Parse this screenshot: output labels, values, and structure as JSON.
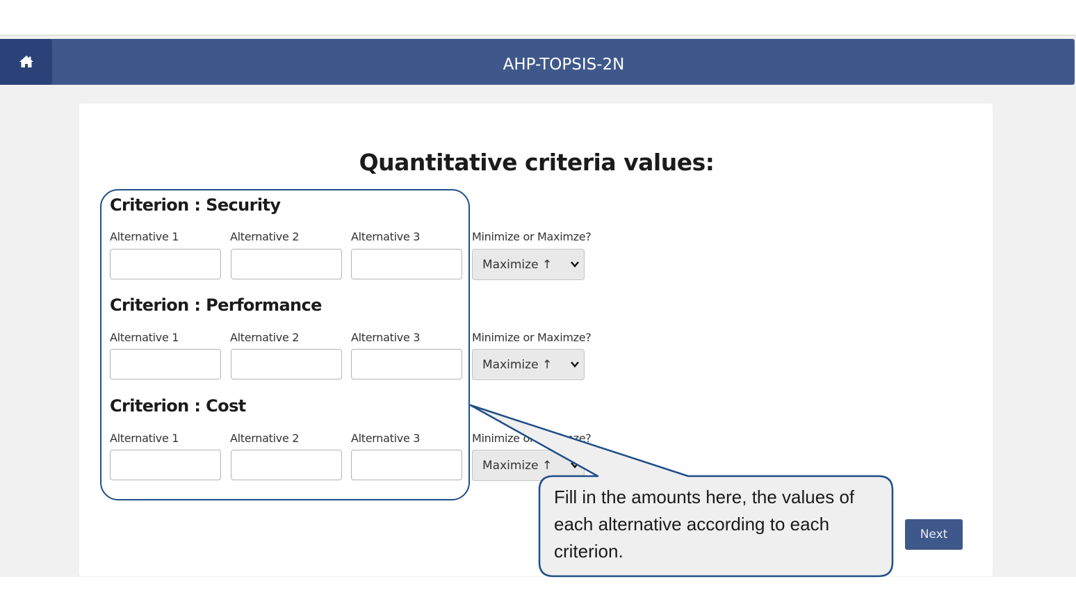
{
  "header": {
    "title": "AHP-TOPSIS-2N",
    "home_icon": "home-icon"
  },
  "page": {
    "title": "Quantitative criteria values:"
  },
  "criteria": [
    {
      "title": "Criterion : Security",
      "alt_labels": [
        "Alternative 1",
        "Alternative 2",
        "Alternative 3"
      ],
      "values": [
        "",
        "",
        ""
      ],
      "direction_label": "Minimize or Maximze?",
      "direction_value": "Maximize ↑"
    },
    {
      "title": "Criterion : Performance",
      "alt_labels": [
        "Alternative 1",
        "Alternative 2",
        "Alternative 3"
      ],
      "values": [
        "",
        "",
        ""
      ],
      "direction_label": "Minimize or Maximze?",
      "direction_value": "Maximize ↑"
    },
    {
      "title": "Criterion : Cost",
      "alt_labels": [
        "Alternative 1",
        "Alternative 2",
        "Alternative 3"
      ],
      "values": [
        "",
        "",
        ""
      ],
      "direction_label": "Minimize or Maximze?",
      "direction_value": "Maximize ↑"
    }
  ],
  "callout": {
    "lines": [
      "Fill in the amounts here, the values of",
      "each alternative according to each",
      "criterion."
    ]
  },
  "footer": {
    "next_label": "Next"
  },
  "colors": {
    "navbar": "#3f588c",
    "home_button": "#2b4278",
    "annotation": "#1f4e87"
  }
}
